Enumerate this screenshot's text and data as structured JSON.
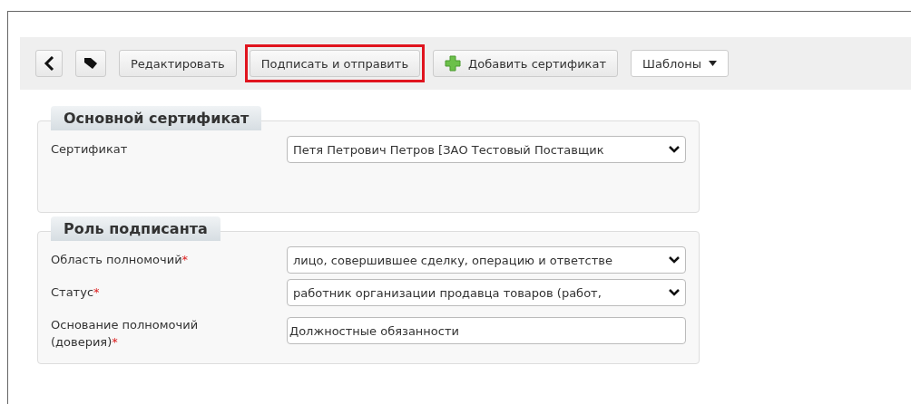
{
  "toolbar": [
    {
      "kind": "back",
      "highlighted": false
    },
    {
      "kind": "tag",
      "highlighted": false
    },
    {
      "kind": "button",
      "label": "Редактировать",
      "highlighted": false
    },
    {
      "kind": "button",
      "label": "Подписать и отправить",
      "highlighted": true
    },
    {
      "kind": "add",
      "label": "Добавить сертификат",
      "highlighted": false
    },
    {
      "kind": "dropdown",
      "label": "Шаблоны",
      "highlighted": false
    }
  ],
  "sections": [
    {
      "title": "Основной сертификат",
      "fields": [
        {
          "kind": "select",
          "label": "Сертификат",
          "value": "Петя Петрович Петров [ЗАО Тестовый Поставщик"
        }
      ]
    },
    {
      "title": "Роль подписанта",
      "fields": [
        {
          "kind": "select",
          "label": "Область полномочий",
          "required_mark": "*",
          "value": "лицо, совершившее сделку, операцию и ответстве"
        },
        {
          "kind": "select",
          "label": "Статус",
          "required_mark": "*",
          "value": "работник организации продавца товаров (работ,"
        },
        {
          "kind": "text",
          "label": "Основание полномочий (доверия)",
          "required_mark": "*",
          "value": "Должностные обязанности"
        }
      ]
    }
  ]
}
